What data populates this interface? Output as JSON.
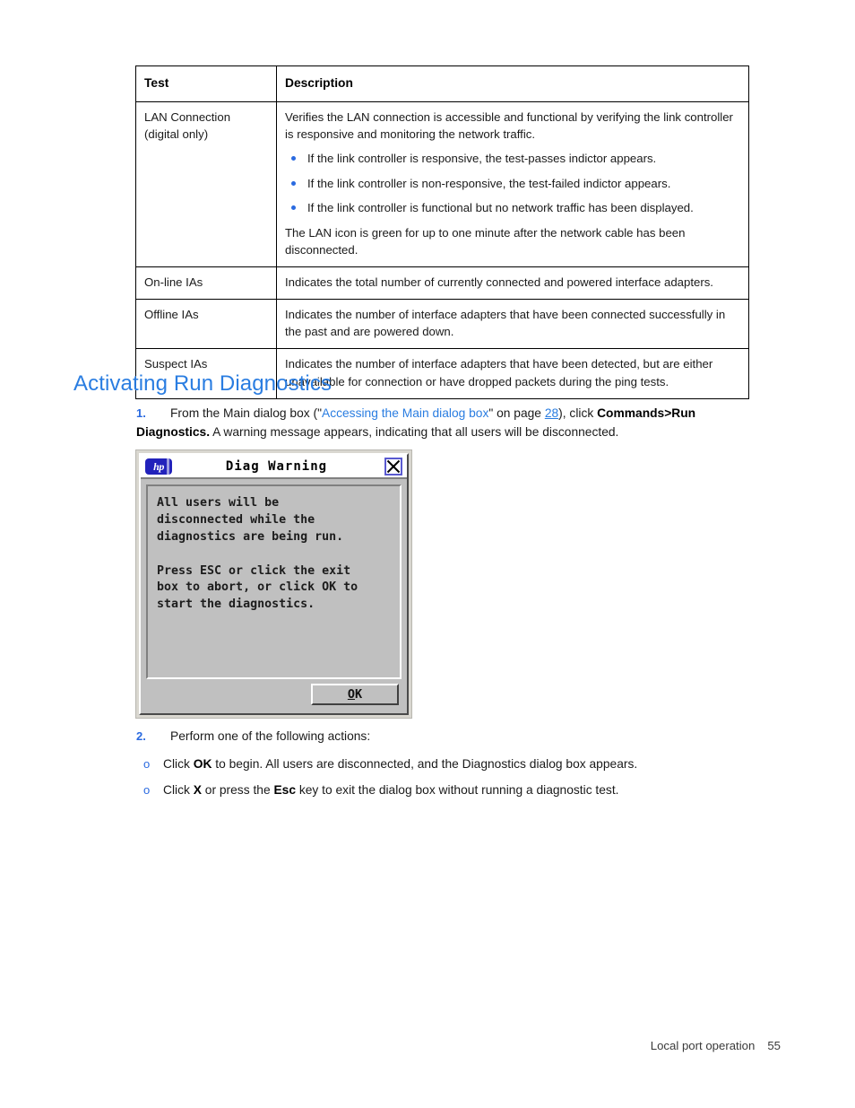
{
  "table": {
    "headers": [
      "Test",
      "Description"
    ],
    "rows": [
      {
        "test_line1": "LAN Connection",
        "test_line2": "(digital only)",
        "desc_intro": "Verifies the LAN connection is accessible and functional by verifying the link controller is responsive and monitoring the network traffic.",
        "bullets": [
          "If the link controller is responsive, the test-passes indictor appears.",
          "If the link controller is non-responsive, the test-failed indictor appears.",
          "If the link controller is functional but no network traffic has been displayed."
        ],
        "desc_outro": "The LAN icon is green for up to one minute after the network cable has been disconnected."
      },
      {
        "test": "On-line IAs",
        "desc": "Indicates the total number of currently connected and powered interface adapters."
      },
      {
        "test": "Offline IAs",
        "desc": "Indicates the number of interface adapters that have been connected successfully in the past and are powered down."
      },
      {
        "test": "Suspect IAs",
        "desc": "Indicates the number of interface adapters that have been detected, but are either unavailable for connection or have dropped packets during the ping tests."
      }
    ]
  },
  "heading": "Activating Run Diagnostics",
  "steps": {
    "step1": {
      "number": "1.",
      "text_before_link": "From the Main dialog box (\"",
      "link_text": "Accessing the Main dialog box",
      "text_after_link": "\" on page ",
      "page_link": "28",
      "text_mid": "), click ",
      "bold_command": "Commands>Run Diagnostics.",
      "text_end": " A warning message appears, indicating that all users will be disconnected."
    },
    "step2": {
      "number": "2.",
      "text": "Perform one of the following actions:",
      "options": [
        {
          "lead": "Click ",
          "bold": "OK",
          "rest": " to begin. All users are disconnected, and the Diagnostics dialog box appears."
        },
        {
          "lead": "Click ",
          "bold": "X",
          "mid": " or press the ",
          "bold2": "Esc",
          "rest": " key to exit the dialog box without running a diagnostic test."
        }
      ]
    }
  },
  "dialog": {
    "logo_text": "hp",
    "title": "Diag Warning",
    "close_label": "X",
    "message": "All users will be\ndisconnected while the\ndiagnostics are being run.\n\nPress ESC or click the exit\nbox to abort, or click OK to\nstart the diagnostics.",
    "ok_accel": "O",
    "ok_rest": "K"
  },
  "footer": {
    "label": "Local port operation",
    "page_number": "55"
  },
  "colors": {
    "link_blue": "#2a7de1",
    "bullet_blue": "#2a6ae0",
    "heading_blue": "#2a7de1",
    "dialog_face": "#c0c0c0",
    "hp_logo_blue": "#2222bb"
  }
}
